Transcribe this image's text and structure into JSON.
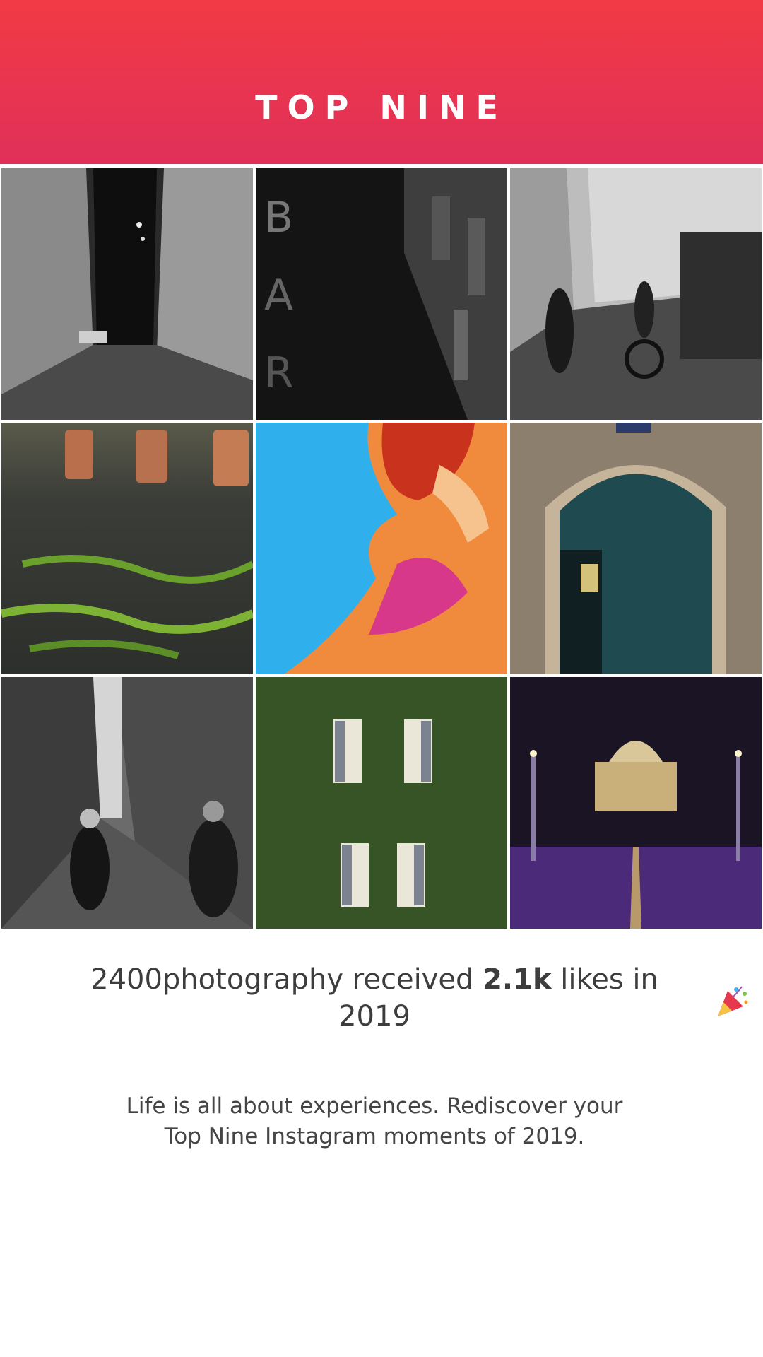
{
  "header": {
    "title": "TOP NINE"
  },
  "photos": [
    {
      "name": "dark-alley-bw"
    },
    {
      "name": "dark-building-sign-bw"
    },
    {
      "name": "street-cyclist-bw"
    },
    {
      "name": "mossy-cobblestones"
    },
    {
      "name": "colorful-sculpture-sky"
    },
    {
      "name": "teal-arched-door"
    },
    {
      "name": "alley-pedestrians-bw"
    },
    {
      "name": "ivy-covered-windows"
    },
    {
      "name": "st-peters-night"
    }
  ],
  "summary": {
    "username": "2400photography",
    "received_text": "received",
    "likes": "2.1k",
    "likes_suffix": "likes in",
    "year": "2019"
  },
  "tagline": {
    "line1": "Life is all about experiences. Rediscover your",
    "line2": "Top Nine Instagram moments of 2019."
  },
  "icons": {
    "celebration": "party-popper-icon"
  },
  "colors": {
    "header_top": "#f23a44",
    "header_bottom": "#e0305a"
  }
}
